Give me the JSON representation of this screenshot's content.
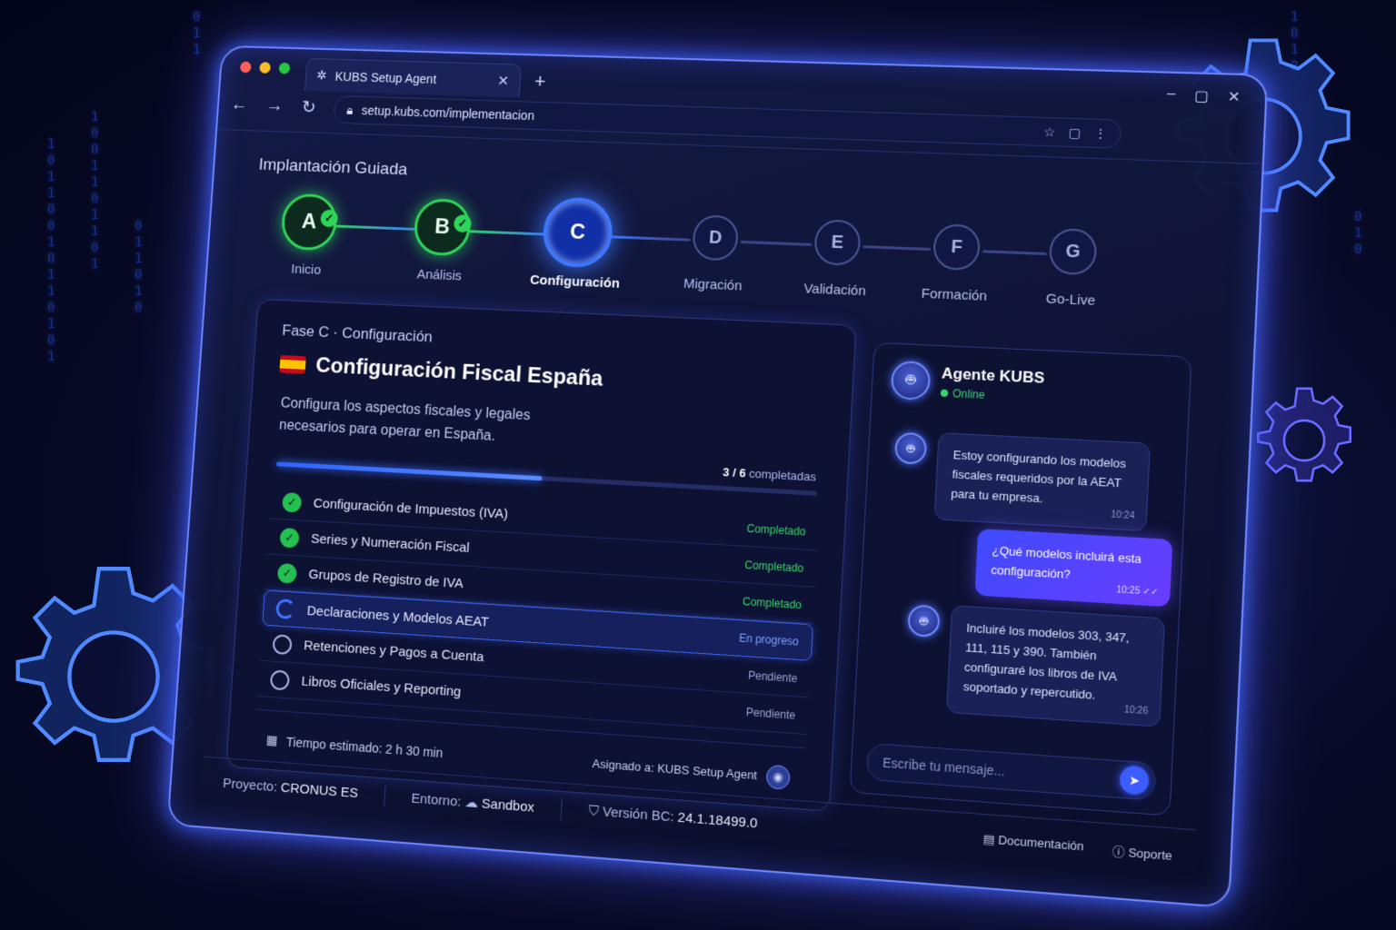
{
  "browser": {
    "tab_title": "KUBS Setup Agent",
    "url": "setup.kubs.com/implementacion"
  },
  "app": {
    "title": "Implantación Guiada"
  },
  "stepper": [
    {
      "letter": "A",
      "label": "Inicio",
      "state": "done"
    },
    {
      "letter": "B",
      "label": "Análisis",
      "state": "done"
    },
    {
      "letter": "C",
      "label": "Configuración",
      "state": "active"
    },
    {
      "letter": "D",
      "label": "Migración",
      "state": "pending"
    },
    {
      "letter": "E",
      "label": "Validación",
      "state": "pending"
    },
    {
      "letter": "F",
      "label": "Formación",
      "state": "pending"
    },
    {
      "letter": "G",
      "label": "Go-Live",
      "state": "pending"
    }
  ],
  "phase": {
    "label": "Fase C · Configuración",
    "title": "Configuración Fiscal España",
    "description": "Configura los aspectos fiscales y legales necesarios para operar en España.",
    "progress_done": "3 / 6",
    "progress_suffix": "completadas",
    "progress_fraction": 0.5,
    "tasks": [
      {
        "name": "Configuración de Impuestos (IVA)",
        "status": "Completado",
        "state": "done"
      },
      {
        "name": "Series y Numeración Fiscal",
        "status": "Completado",
        "state": "done"
      },
      {
        "name": "Grupos de Registro de IVA",
        "status": "Completado",
        "state": "done"
      },
      {
        "name": "Declaraciones y Modelos AEAT",
        "status": "En progreso",
        "state": "progress"
      },
      {
        "name": "Retenciones y Pagos a Cuenta",
        "status": "Pendiente",
        "state": "pending"
      },
      {
        "name": "Libros Oficiales y Reporting",
        "status": "Pendiente",
        "state": "pending"
      }
    ],
    "estimated_time": "Tiempo estimado: 2 h 30 min",
    "assigned": "Asignado a: KUBS Setup Agent"
  },
  "chat": {
    "agent_name": "Agente KUBS",
    "status": "Online",
    "messages": [
      {
        "from": "bot",
        "text": "Estoy configurando los modelos fiscales requeridos por la AEAT para tu empresa.",
        "time": "10:24"
      },
      {
        "from": "user",
        "text": "¿Qué modelos incluirá esta configuración?",
        "time": "10:25 ✓✓"
      },
      {
        "from": "bot",
        "text": "Incluiré los modelos 303, 347, 111, 115 y 390. También configuraré los libros de IVA soportado y repercutido.",
        "time": "10:26"
      }
    ],
    "input_placeholder": "Escribe tu mensaje..."
  },
  "statusbar": {
    "project_label": "Proyecto:",
    "project_value": "CRONUS ES",
    "env_label": "Entorno:",
    "env_value": "Sandbox",
    "version_label": "Versión BC:",
    "version_value": "24.1.18499.0",
    "docs": "Documentación",
    "support": "Soporte"
  },
  "colors": {
    "accent": "#3d78ff",
    "success": "#2fd45a",
    "user_bubble": "#5a44ff"
  }
}
